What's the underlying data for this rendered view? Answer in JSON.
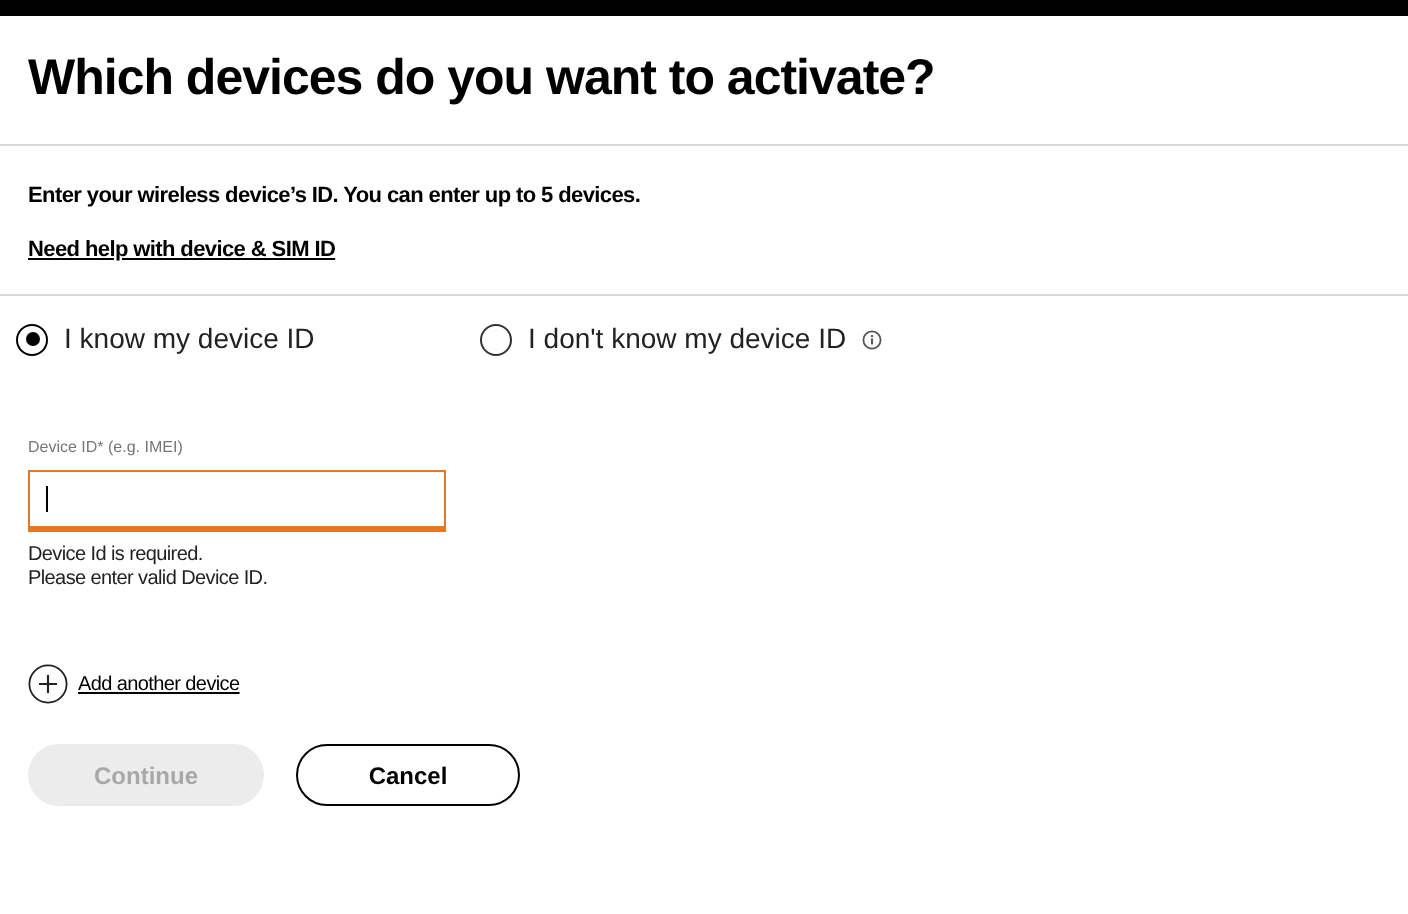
{
  "title": "Which devices do you want to activate?",
  "intro": "Enter your wireless device’s ID. You can enter up to 5 devices.",
  "help_link": "Need help with device & SIM ID",
  "options": [
    {
      "label": "I know my device ID",
      "selected": true,
      "info": false
    },
    {
      "label": "I don't know my device ID",
      "selected": false,
      "info": true
    }
  ],
  "device_field": {
    "label": "Device ID* (e.g. IMEI)",
    "error": true,
    "errors": [
      "Device Id is required.",
      "Please enter valid Device ID."
    ]
  },
  "add_link": "Add another device",
  "buttons": [
    {
      "label": "Continue",
      "kind": "primary",
      "disabled": true
    },
    {
      "label": "Cancel",
      "kind": "secondary",
      "disabled": false
    }
  ]
}
